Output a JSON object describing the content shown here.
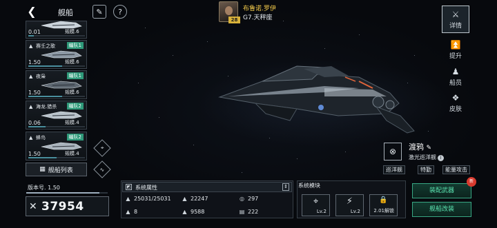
{
  "header": {
    "back_icon": "back-chevron-icon",
    "title": "舰船",
    "buttons": [
      {
        "icon": "feather-icon",
        "glyph": "✎"
      },
      {
        "icon": "help-icon",
        "glyph": "?"
      }
    ]
  },
  "captain": {
    "name": "布鲁诺.罗伊",
    "level": "28",
    "ship_slot": "G7.天秤座"
  },
  "ship_list": [
    {
      "name": "",
      "tag": "",
      "cost": "0.01",
      "class": "规模.6",
      "progress": 0.1,
      "hull_color": "#c9d2da"
    },
    {
      "name": "赛壬之歌",
      "tag": "编队1",
      "cost": "1.50",
      "class": "规模.6",
      "progress": 0.6,
      "hull_color": "#8d99a5"
    },
    {
      "name": "夜枭",
      "tag": "编队1",
      "cost": "1.50",
      "class": "规模.6",
      "progress": 0.6,
      "hull_color": "#5c6670"
    },
    {
      "name": "海龙.猎杀",
      "tag": "编队2",
      "cost": "0.06",
      "class": "规模.4",
      "progress": 0.3,
      "hull_color": "#b8c2ca"
    },
    {
      "name": "蜂鸟",
      "tag": "编队2",
      "cost": "1.50",
      "class": "规模.4",
      "progress": 0.5,
      "hull_color": "#a9b3bc"
    }
  ],
  "ship_list_button": {
    "icon": "grid-icon",
    "label": "舰船列表"
  },
  "side_tabs": [
    {
      "icon": "detail-icon",
      "label": "详情",
      "active": true
    },
    {
      "icon": "upgrade-icon",
      "label": "提升",
      "active": false
    },
    {
      "icon": "crew-icon",
      "label": "船员",
      "active": false
    },
    {
      "icon": "skin-icon",
      "label": "皮肤",
      "active": false
    }
  ],
  "ship": {
    "name": "渡鸦",
    "type": "激光巡洋舰",
    "traits": [
      "巡洋舰",
      "特勤",
      "能量攻击"
    ]
  },
  "version": {
    "label": "版本号. 1.50",
    "progress": 0.9
  },
  "power": {
    "icon": "crossed-swords-icon",
    "value": "37954"
  },
  "attributes": {
    "title": "系统属性",
    "stats": [
      {
        "icon": "hull-icon",
        "glyph": "▲",
        "value": "25031/25031"
      },
      {
        "icon": "armor-icon",
        "glyph": "▲",
        "value": "22247"
      },
      {
        "icon": "shield-icon",
        "glyph": "◎",
        "value": "297"
      },
      {
        "icon": "speed-icon",
        "glyph": "▲",
        "value": "8"
      },
      {
        "icon": "cargo-icon",
        "glyph": "▲",
        "value": "9588"
      },
      {
        "icon": "storage-icon",
        "glyph": "▤",
        "value": "222"
      }
    ]
  },
  "modules": {
    "title": "系统模块",
    "items": [
      {
        "icon": "targeting-module-icon",
        "glyph": "⌖",
        "label": "Lv.2"
      },
      {
        "icon": "power-module-icon",
        "glyph": "⚡",
        "label": "Lv.2"
      },
      {
        "icon": "lock-icon",
        "glyph": "🔒",
        "label": "2.01解锁"
      }
    ]
  },
  "actions": {
    "equip_label": "装配武器",
    "new_badge": "新",
    "refit_label": "舰船改装"
  },
  "colors": {
    "accent_green": "#38a884",
    "captain_gold": "#f1c94a",
    "tag_green": "#2f9a7a"
  }
}
